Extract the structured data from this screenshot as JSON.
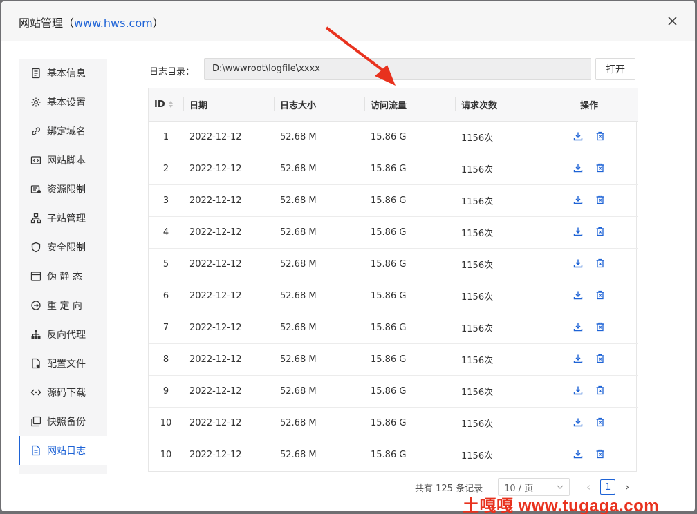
{
  "dialog": {
    "title_prefix": "网站管理（",
    "title_link": "www.hws.com",
    "title_suffix": "）"
  },
  "sidebar": {
    "items": [
      {
        "label": "基本信息",
        "icon": "document-icon"
      },
      {
        "label": "基本设置",
        "icon": "gear-icon"
      },
      {
        "label": "绑定域名",
        "icon": "link-icon"
      },
      {
        "label": "网站脚本",
        "icon": "code-icon"
      },
      {
        "label": "资源限制",
        "icon": "resource-icon"
      },
      {
        "label": "子站管理",
        "icon": "sitemap-icon"
      },
      {
        "label": "安全限制",
        "icon": "shield-icon"
      },
      {
        "label": "伪 静 态",
        "icon": "window-icon"
      },
      {
        "label": "重 定 向",
        "icon": "redirect-icon"
      },
      {
        "label": "反向代理",
        "icon": "network-icon"
      },
      {
        "label": "配置文件",
        "icon": "file-config-icon"
      },
      {
        "label": "源码下载",
        "icon": "source-code-icon"
      },
      {
        "label": "快照备份",
        "icon": "copy-icon"
      },
      {
        "label": "网站日志",
        "icon": "log-file-icon",
        "active": true
      }
    ]
  },
  "log_dir": {
    "label": "日志目录：",
    "value": "D:\\wwwroot\\logfile\\xxxx",
    "open_label": "打开"
  },
  "table": {
    "headers": {
      "id": "ID",
      "date": "日期",
      "size": "日志大小",
      "traffic": "访问流量",
      "requests": "请求次数",
      "ops": "操作"
    },
    "rows": [
      {
        "id": "1",
        "date": "2022-12-12",
        "size": "52.68 M",
        "traffic": "15.86 G",
        "requests": "1156次"
      },
      {
        "id": "2",
        "date": "2022-12-12",
        "size": "52.68 M",
        "traffic": "15.86 G",
        "requests": "1156次"
      },
      {
        "id": "3",
        "date": "2022-12-12",
        "size": "52.68 M",
        "traffic": "15.86 G",
        "requests": "1156次"
      },
      {
        "id": "4",
        "date": "2022-12-12",
        "size": "52.68 M",
        "traffic": "15.86 G",
        "requests": "1156次"
      },
      {
        "id": "5",
        "date": "2022-12-12",
        "size": "52.68 M",
        "traffic": "15.86 G",
        "requests": "1156次"
      },
      {
        "id": "6",
        "date": "2022-12-12",
        "size": "52.68 M",
        "traffic": "15.86 G",
        "requests": "1156次"
      },
      {
        "id": "7",
        "date": "2022-12-12",
        "size": "52.68 M",
        "traffic": "15.86 G",
        "requests": "1156次"
      },
      {
        "id": "8",
        "date": "2022-12-12",
        "size": "52.68 M",
        "traffic": "15.86 G",
        "requests": "1156次"
      },
      {
        "id": "9",
        "date": "2022-12-12",
        "size": "52.68 M",
        "traffic": "15.86 G",
        "requests": "1156次"
      },
      {
        "id": "10",
        "date": "2022-12-12",
        "size": "52.68 M",
        "traffic": "15.86 G",
        "requests": "1156次"
      },
      {
        "id": "10",
        "date": "2022-12-12",
        "size": "52.68 M",
        "traffic": "15.86 G",
        "requests": "1156次"
      }
    ]
  },
  "pagination": {
    "total_text": "共有 125 条记录",
    "page_size": "10 / 页",
    "current_page": "1"
  },
  "colors": {
    "accent": "#1e63d6",
    "annotation_arrow": "#e8321e",
    "watermark": "#e8321e"
  },
  "watermark": {
    "text": "土嘎嘎 www.tugaga.com"
  }
}
